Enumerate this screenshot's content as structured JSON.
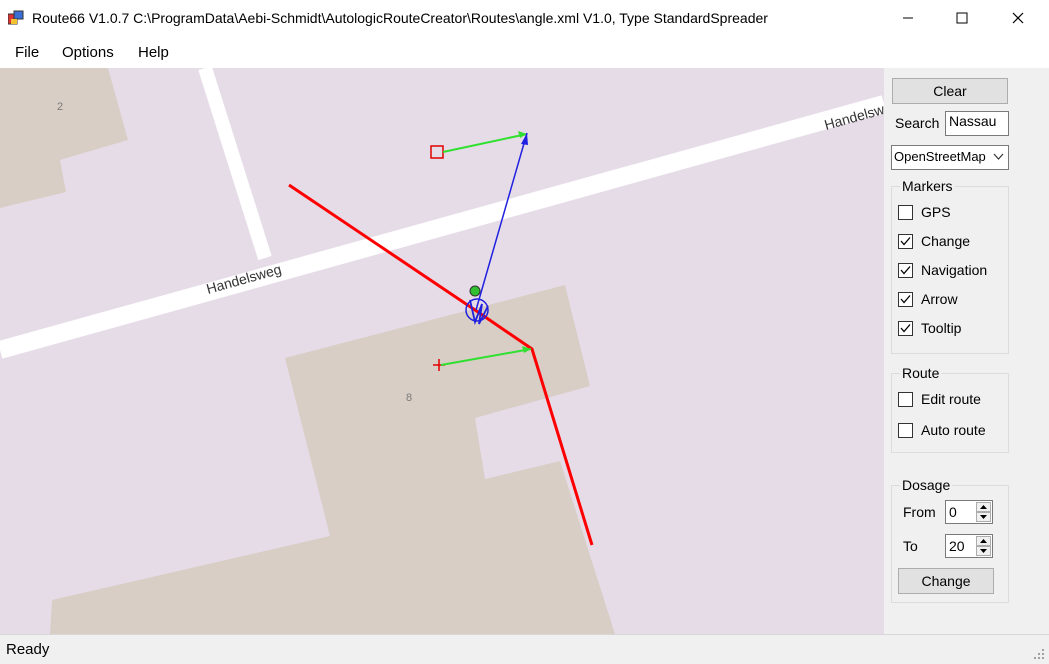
{
  "window": {
    "title": "Route66 V1.0.7 C:\\ProgramData\\Aebi-Schmidt\\AutologicRouteCreator\\Routes\\angle.xml V1.0, Type StandardSpreader",
    "controls": [
      "minimize",
      "maximize",
      "close"
    ]
  },
  "menu": {
    "file": "File",
    "options": "Options",
    "help": "Help"
  },
  "map": {
    "street_label_main": "Handelsweg",
    "street_label_top": "Handelsw",
    "building_label_left": "2",
    "building_label_center": "8",
    "colors": {
      "background": "#e6dce8",
      "building": "#d8cec6",
      "road": "#ffffff",
      "route": "#ff0000",
      "arrow_blue": "#2020e0",
      "arrow_green": "#30e030"
    }
  },
  "panel": {
    "clear_button": "Clear",
    "search_label": "Search",
    "search_value": "Nassau",
    "map_provider": "OpenStreetMap",
    "markers": {
      "title": "Markers",
      "items": [
        {
          "label": "GPS",
          "checked": false
        },
        {
          "label": "Change",
          "checked": true
        },
        {
          "label": "Navigation",
          "checked": true
        },
        {
          "label": "Arrow",
          "checked": true
        },
        {
          "label": "Tooltip",
          "checked": true
        }
      ]
    },
    "route": {
      "title": "Route",
      "items": [
        {
          "label": "Edit route",
          "checked": false
        },
        {
          "label": "Auto route",
          "checked": false
        }
      ]
    },
    "dosage": {
      "title": "Dosage",
      "from_label": "From",
      "from_value": "0",
      "to_label": "To",
      "to_value": "20",
      "change_button": "Change"
    }
  },
  "status": {
    "text": "Ready"
  }
}
